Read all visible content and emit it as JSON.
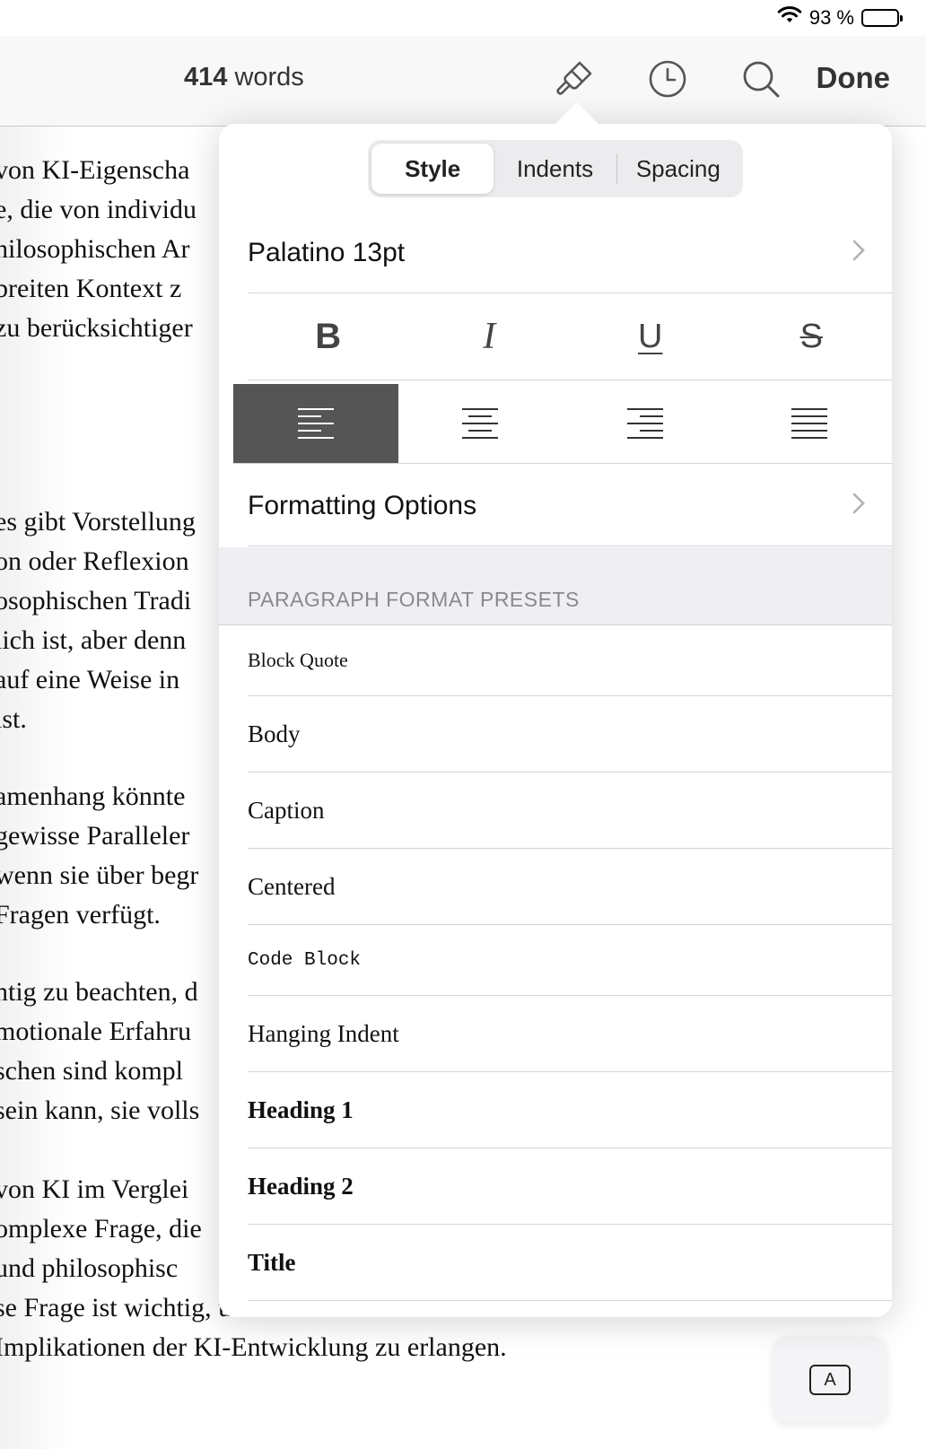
{
  "status_bar": {
    "battery_text": "93 %",
    "battery_level": 0.93,
    "icons": [
      "wifi-icon",
      "battery-icon"
    ]
  },
  "toolbar": {
    "word_count_number": "414",
    "word_count_unit": "words",
    "icons": [
      "brush-icon",
      "clock-icon",
      "search-icon"
    ],
    "done_label": "Done"
  },
  "document": {
    "lines": [
      "von KI-Eigenscha",
      "e, die von individu",
      "hilosophischen Ar",
      "breiten Kontext z",
      "zu berücksichtiger",
      "es gibt Vorstellung",
      "on oder Reflexion",
      "osophischen Tradi",
      "lich ist, aber denn",
      "auf eine Weise in",
      "ist.",
      "amenhang könnte",
      "gewisse Paralleler",
      "wenn sie über begr",
      "Fragen verfügt.",
      "ntig zu beachten, d",
      "motionale Erfahru",
      "schen sind kompl",
      "sein kann, sie volls",
      "von KI im Verglei",
      "omplexe Frage, die",
      "und philosophisc",
      "se Frage ist wichtig, um ein tieferes Verständnis der",
      "Implikationen der KI-Entwicklung zu erlangen."
    ]
  },
  "popover": {
    "tabs": [
      {
        "label": "Style",
        "active": true
      },
      {
        "label": "Indents",
        "active": false
      },
      {
        "label": "Spacing",
        "active": false
      }
    ],
    "font_row": "Palatino 13pt",
    "format_buttons": {
      "bold": "B",
      "italic": "I",
      "underline": "U",
      "strike": "S"
    },
    "alignment_active": "left",
    "alignment_icons": [
      "align-left-icon",
      "align-center-icon",
      "align-right-icon",
      "align-justify-icon"
    ],
    "formatting_options": "Formatting Options",
    "presets_title": "PARAGRAPH FORMAT PRESETS",
    "presets": [
      "Block Quote",
      "Body",
      "Caption",
      "Centered",
      "Code Block",
      "Hanging Indent",
      "Heading 1",
      "Heading 2",
      "Title"
    ]
  },
  "keyboard_button": {
    "label": "A"
  },
  "colors": {
    "active_alignment_bg": "#555555",
    "section_band_bg": "#efeff3"
  }
}
